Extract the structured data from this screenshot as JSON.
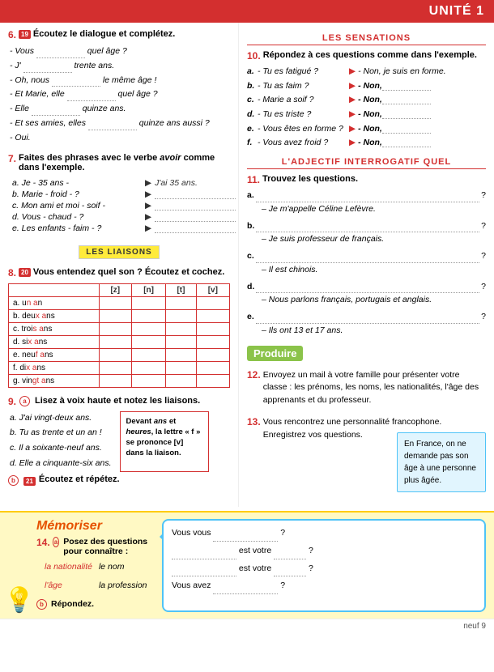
{
  "header": {
    "unit_label": "UNITÉ 1"
  },
  "left_col": {
    "exercise6": {
      "number": "6.",
      "audio": "19",
      "title": "Écoutez le dialogue et complétez.",
      "lines": [
        "- Vous .......... quel âge ?",
        "- J' .......... trente ans.",
        "- Oh, nous .......... le même âge !",
        "- Et Marie, elle .......... quel âge ?",
        "- Elle .......... quinze ans.",
        "- Et ses amies, elles .......... quinze ans aussi ?",
        "- Oui."
      ]
    },
    "exercise7": {
      "number": "7.",
      "title": "Faites des phrases avec le verbe avoir comme dans l'exemple.",
      "rows": [
        {
          "label": "a. Je - 35 ans -",
          "example": "J'ai 35 ans.",
          "dotted": false
        },
        {
          "label": "b. Marie - froid - ?",
          "example": null,
          "dotted": true
        },
        {
          "label": "c. Mon ami et moi - soif -",
          "example": null,
          "dotted": true
        },
        {
          "label": "d. Vous - chaud - ?",
          "example": null,
          "dotted": true
        },
        {
          "label": "e. Les enfants - faim - ?",
          "example": null,
          "dotted": true
        }
      ]
    },
    "liaisons_label": "LES LIAISONS",
    "exercise8": {
      "number": "8.",
      "audio": "20",
      "title": "Vous entendez quel son ? Écoutez et cochez.",
      "headers": [
        "[z]",
        "[n]",
        "[t]",
        "[v]"
      ],
      "rows": [
        {
          "label": "a. un an",
          "liaison": ""
        },
        {
          "label": "b. deux ans",
          "liaison": ""
        },
        {
          "label": "c. trois ans",
          "liaison": ""
        },
        {
          "label": "d. six ans",
          "liaison": ""
        },
        {
          "label": "e. neuf ans",
          "liaison": ""
        },
        {
          "label": "f. dix ans",
          "liaison": ""
        },
        {
          "label": "g. vingt ans",
          "liaison": ""
        }
      ]
    },
    "exercise9": {
      "number": "9.",
      "part_a_label": "a",
      "part_a_title": "Lisez à voix haute et notez les liaisons.",
      "sentences": [
        "a. J'ai vingt-deux ans.",
        "b. Tu as trente et un an !",
        "c. Il a soixante-neuf ans.",
        "d. Elle a cinquante-six ans."
      ],
      "note": {
        "line1": "Devant ans et",
        "line2": "heures, la lettre",
        "line3": "« f » se prononce",
        "line4": "[v] dans la liaison."
      },
      "part_b_label": "b",
      "part_b_audio": "21",
      "part_b_title": "Écoutez et répétez."
    }
  },
  "right_col": {
    "section_label": "LES SENSATIONS",
    "exercise10": {
      "number": "10.",
      "title": "Répondez à ces questions comme dans l'exemple.",
      "rows": [
        {
          "label": "a.",
          "question": "- Tu es fatigué ?",
          "answer_prefix": "- Non, je suis en forme."
        },
        {
          "label": "b.",
          "question": "- Tu as faim ?",
          "answer_prefix": "- Non,",
          "dotted": true
        },
        {
          "label": "c.",
          "question": "- Marie a soif ?",
          "answer_prefix": "- Non,",
          "dotted": true
        },
        {
          "label": "d.",
          "question": "- Tu es triste ?",
          "answer_prefix": "- Non,",
          "dotted": true
        },
        {
          "label": "e.",
          "question": "- Vous êtes en forme ?",
          "answer_prefix": "- Non,",
          "dotted": true
        },
        {
          "label": "f.",
          "question": "- Vous avez froid ?",
          "answer_prefix": "- Non,",
          "dotted": true
        }
      ]
    },
    "adjectif_label": "L'ADJECTIF INTERROGATIF QUEL",
    "exercise11": {
      "number": "11.",
      "title": "Trouvez les questions.",
      "blocks": [
        {
          "label": "a.",
          "answer": "– Je m'appelle Céline Lefèvre."
        },
        {
          "label": "b.",
          "answer": "– Je suis professeur de français."
        },
        {
          "label": "c.",
          "answer": "– Il est chinois."
        },
        {
          "label": "d.",
          "answer": "– Nous parlons français, portugais et anglais."
        },
        {
          "label": "e.",
          "answer": "– Ils ont 13 et 17 ans."
        }
      ]
    },
    "produire_label": "Produire",
    "exercise12": {
      "number": "12.",
      "text": "Envoyez un mail à votre famille pour présenter votre classe : les prénoms, les noms, les nationalités, l'âge des apprenants et du professeur."
    },
    "exercise13": {
      "number": "13.",
      "text": "Vous rencontrez une personnalité francophone. Enregistrez vos questions.",
      "info_box": "En France, on ne demande pas son âge à une personne plus âgée."
    }
  },
  "memoriser": {
    "title": "Mémoriser",
    "exercise14": {
      "number": "14.",
      "part_a_label": "a",
      "title": "Posez des questions pour connaître :",
      "items": [
        {
          "label": "la nationalité",
          "link": "le nom"
        },
        {
          "label": "l'âge",
          "link": "la profession"
        }
      ],
      "part_b_label": "b",
      "part_b_title": "Répondez."
    },
    "bubble": {
      "lines": [
        "Vous vous ………………………… ?",
        "………………………… est votre ………………… ?",
        "………………………… est votre ………………… ?",
        "Vous avez ………………………… ?"
      ]
    }
  },
  "footer": {
    "page": "neuf 9"
  }
}
